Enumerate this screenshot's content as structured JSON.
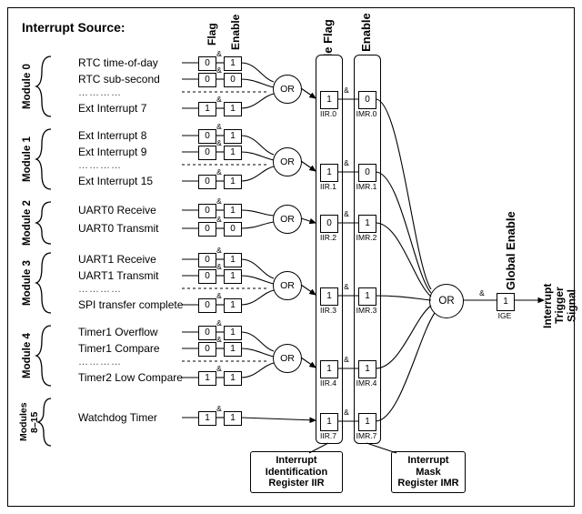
{
  "title": "Interrupt Source:",
  "col_flag": "Flag",
  "col_enable": "Enable",
  "col_mod_flag": "Module Flag",
  "col_mod_enable": "Module Enable",
  "col_global_enable": "Global Enable",
  "or_label": "OR",
  "and_label": "&",
  "ige_bit": "1",
  "ige_name": "IGE",
  "out_signal": "Interrupt\nTrigger\nSignal",
  "iir_caption": "Interrupt\nIdentification\nRegister IIR",
  "imr_caption": "Interrupt\nMask\nRegister IMR",
  "mod0": {
    "name": "Module 0",
    "src": [
      "RTC time-of-day",
      "RTC sub-second",
      "Ext Interrupt 7"
    ],
    "ell": "…………",
    "flag": [
      "0",
      "0",
      "1"
    ],
    "en": [
      "1",
      "0",
      "1"
    ],
    "iir": "1",
    "iir_name": "IIR.0",
    "imr": "0",
    "imr_name": "IMR.0"
  },
  "mod1": {
    "name": "Module 1",
    "src": [
      "Ext Interrupt 8",
      "Ext Interrupt 9",
      "Ext Interrupt 15"
    ],
    "ell": "…………",
    "flag": [
      "0",
      "0",
      "0"
    ],
    "en": [
      "1",
      "1",
      "1"
    ],
    "iir": "1",
    "iir_name": "IIR.1",
    "imr": "0",
    "imr_name": "IMR.1"
  },
  "mod2": {
    "name": "Module 2",
    "src": [
      "UART0 Receive",
      "UART0 Transmit"
    ],
    "flag": [
      "0",
      "0"
    ],
    "en": [
      "1",
      "0"
    ],
    "iir": "0",
    "iir_name": "IIR.2",
    "imr": "1",
    "imr_name": "IMR.2"
  },
  "mod3": {
    "name": "Module 3",
    "src": [
      "UART1 Receive",
      "UART1 Transmit",
      "SPI transfer complete"
    ],
    "ell": "…………",
    "flag": [
      "0",
      "0",
      "0"
    ],
    "en": [
      "1",
      "1",
      "1"
    ],
    "iir": "1",
    "iir_name": "IIR.3",
    "imr": "1",
    "imr_name": "IMR.3"
  },
  "mod4": {
    "name": "Module 4",
    "src": [
      "Timer1 Overflow",
      "Timer1 Compare",
      "Timer2 Low Compare"
    ],
    "ell": "…………",
    "flag": [
      "0",
      "0",
      "1"
    ],
    "en": [
      "1",
      "1",
      "1"
    ],
    "iir": "1",
    "iir_name": "IIR.4",
    "imr": "1",
    "imr_name": "IMR.4"
  },
  "mod5": {
    "name": "Modules\n8–15",
    "src": [
      "Watchdog Timer"
    ],
    "flag": [
      "1"
    ],
    "en": [
      "1"
    ],
    "iir": "1",
    "iir_name": "IIR.7",
    "imr": "1",
    "imr_name": "IMR.7"
  }
}
